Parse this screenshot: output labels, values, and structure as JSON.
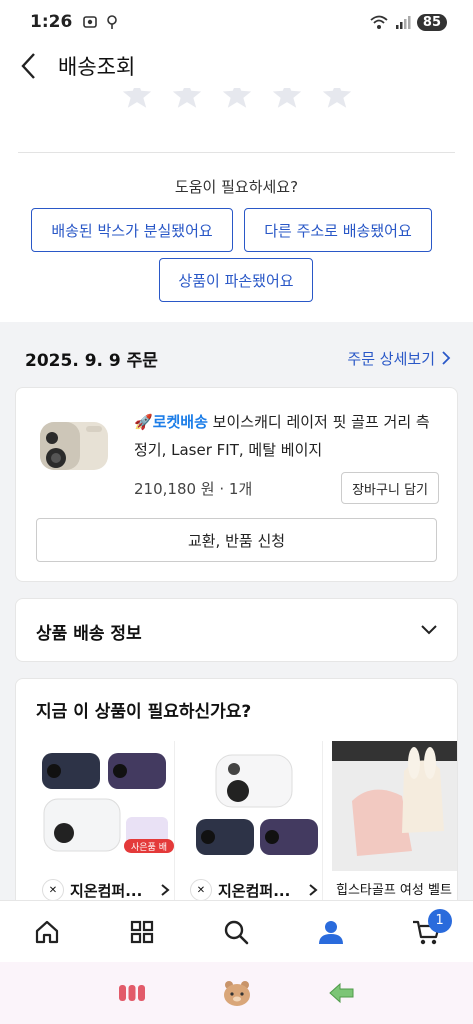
{
  "status": {
    "time": "1:26",
    "battery": "85"
  },
  "header": {
    "title": "배송조회"
  },
  "help": {
    "title": "도움이 필요하세요?",
    "buttons": [
      "배송된 박스가 분실됐어요",
      "다른 주소로 배송됐어요",
      "상품이 파손됐어요"
    ]
  },
  "order": {
    "date": "2025. 9. 9 주문",
    "detail_link": "주문 상세보기",
    "product": {
      "delivery_badge": "로켓배송",
      "name": "보이스캐디 레이저 핏 골프 거리 측정기, Laser FIT, 메탈 베이지",
      "price": "210,180 원 · 1개",
      "cart_button": "장바구니 담기"
    },
    "exchange_button": "교환, 반품 신청"
  },
  "shipping_info": {
    "title": "상품 배송 정보"
  },
  "recommend": {
    "title": "지금 이 상품이 필요하신가요?",
    "items": [
      {
        "label": "지온컴퍼..."
      },
      {
        "label": "지온컴퍼..."
      },
      {
        "label": "힙스타골프 여성 벨트"
      }
    ],
    "gift_tag": "사은품 배"
  },
  "bottom_nav": {
    "cart_badge": "1"
  },
  "colors": {
    "accent": "#2a58c7",
    "rocket": "#1d7ee8"
  }
}
